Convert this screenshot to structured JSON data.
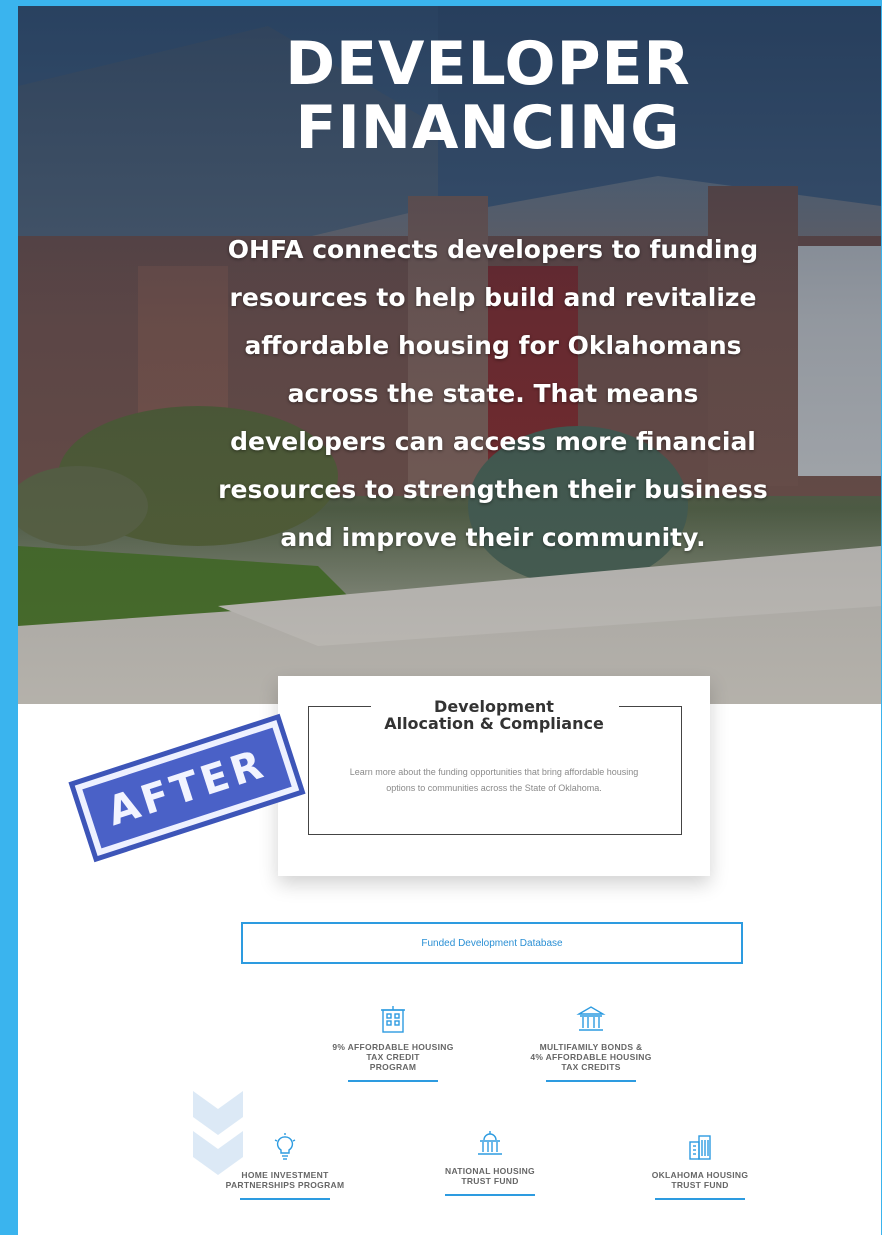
{
  "hero": {
    "title_line1": "DEVELOPER",
    "title_line2": "FINANCING",
    "description": "OHFA connects developers to funding resources to help build and revitalize affordable housing for Oklahomans across the state. That means developers can access more financial resources to strengthen their business and improve their community."
  },
  "card": {
    "title_line1": "Development",
    "title_line2": "Allocation & Compliance",
    "description": "Learn more about the funding opportunities that bring affordable housing options to communities across the State of Oklahoma."
  },
  "stamp": {
    "text": "AFTER"
  },
  "database_button": {
    "label": "Funded Development Database"
  },
  "programs": [
    {
      "label": "9% AFFORDABLE HOUSING\nTAX CREDIT\nPROGRAM",
      "icon": "building-icon"
    },
    {
      "label": "MULTIFAMILY BONDS &\n4% AFFORDABLE HOUSING\nTAX CREDITS",
      "icon": "bank-icon"
    },
    {
      "label": "HOME INVESTMENT\nPARTNERSHIPS PROGRAM",
      "icon": "lightbulb-icon"
    },
    {
      "label": "NATIONAL HOUSING\nTRUST FUND",
      "icon": "capitol-icon"
    },
    {
      "label": "OKLAHOMA HOUSING\nTRUST FUND",
      "icon": "office-building-icon"
    }
  ],
  "colors": {
    "frame": "#3ab4ee",
    "accent": "#2d9be0",
    "stamp": "#4a61c7"
  }
}
